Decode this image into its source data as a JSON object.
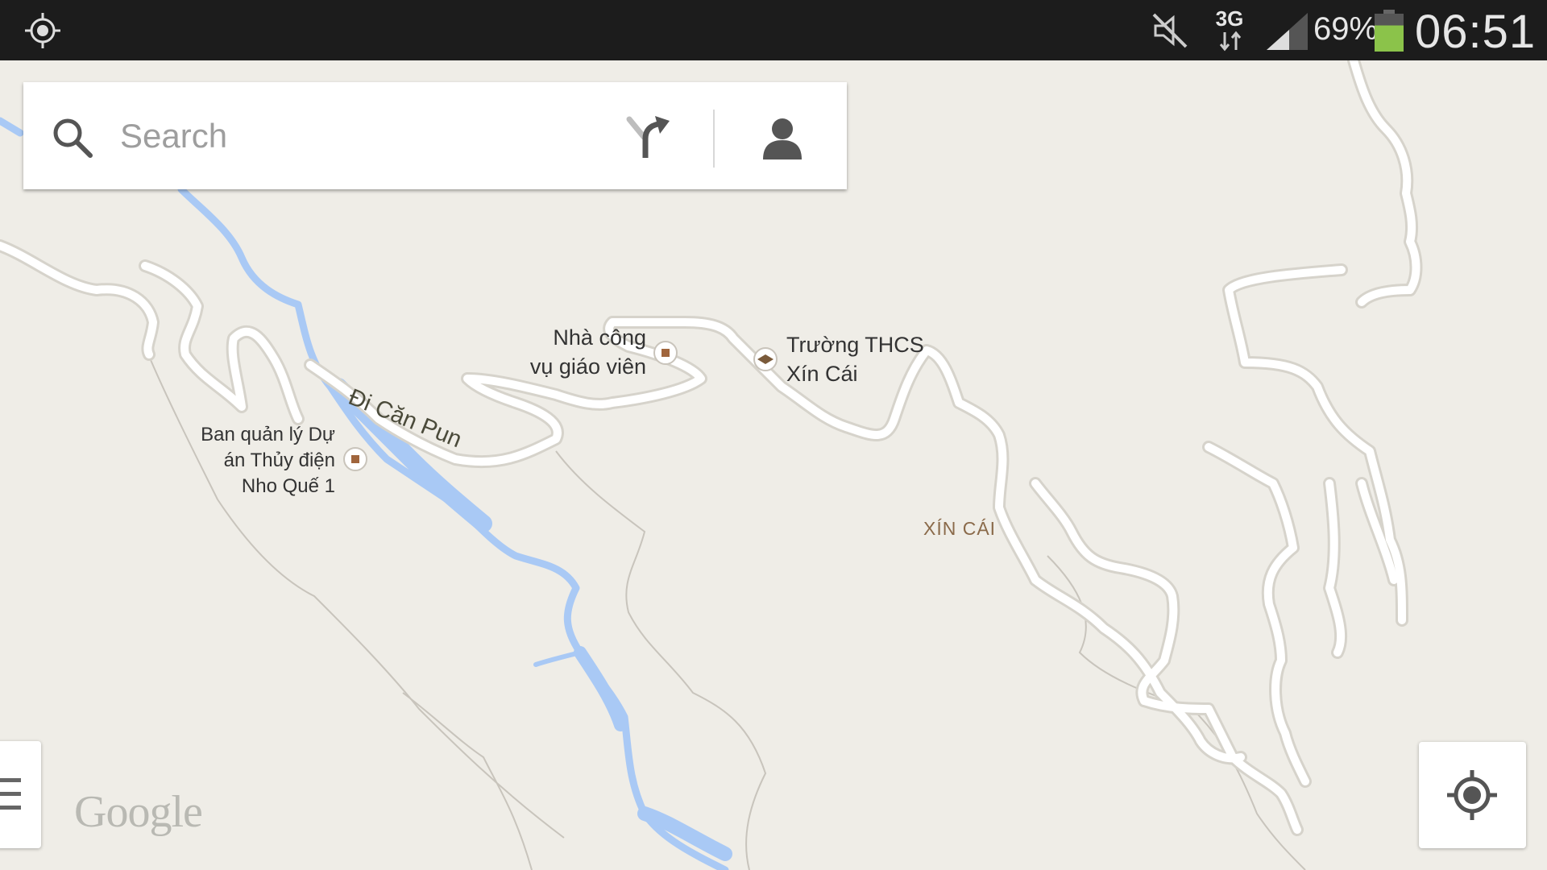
{
  "status_bar": {
    "network": "3G",
    "battery_percent": "69%",
    "battery_level": 0.69,
    "time": "06:51",
    "icons": [
      "location-icon",
      "mute-icon",
      "data-3g-icon",
      "signal-icon",
      "battery-icon"
    ],
    "battery_color": "#8bc34a"
  },
  "search": {
    "placeholder": "Search",
    "value": ""
  },
  "map": {
    "water_color": "#a9c9f5",
    "road_color": "#ffffff",
    "land_color": "#efede7",
    "pois": [
      {
        "label_line1": "Nhà công",
        "label_line2": "vụ giáo viên",
        "icon": "building-icon"
      },
      {
        "label_line1": "Trường THCS",
        "label_line2": "Xín Cái",
        "icon": "school-icon"
      },
      {
        "label_line1": "Ban quản lý Dự",
        "label_line2": "án Thủy điện",
        "label_line3": "Nho Quế 1",
        "icon": "building-icon"
      }
    ],
    "area_label": "XÍN CÁI",
    "road_label": "Đi Căn Pun",
    "attribution": "Google"
  }
}
